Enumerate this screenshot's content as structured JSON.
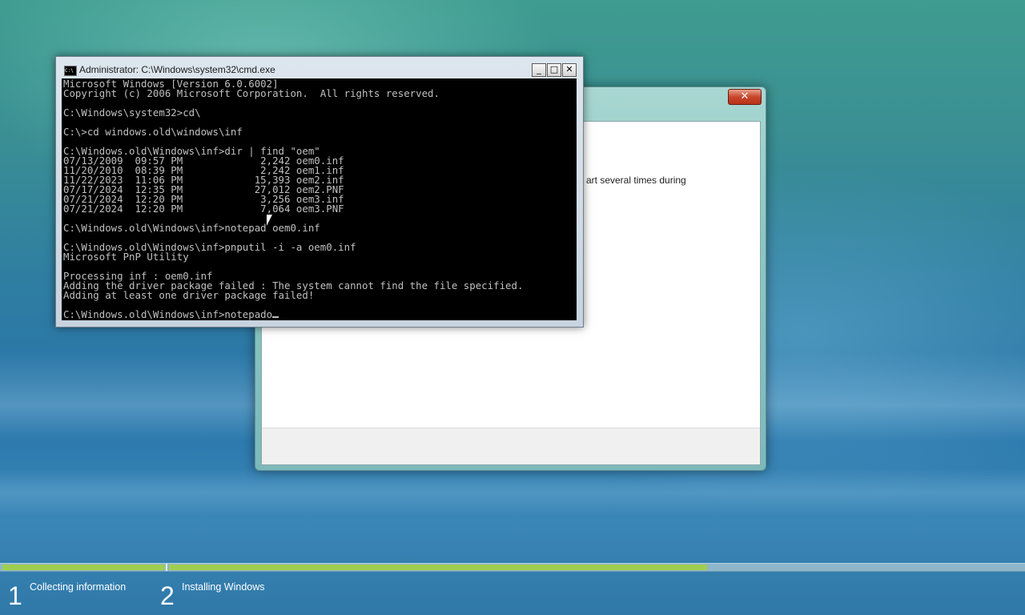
{
  "cmd": {
    "title": "Administrator: C:\\Windows\\system32\\cmd.exe",
    "icon": "cmd-icon",
    "buttons": {
      "minimize": "_",
      "maximize": "□",
      "close": "✕"
    },
    "output": "Microsoft Windows [Version 6.0.6002]\nCopyright (c) 2006 Microsoft Corporation.  All rights reserved.\n\nC:\\Windows\\system32>cd\\\n\nC:\\>cd windows.old\\windows\\inf\n\nC:\\Windows.old\\Windows\\inf>dir | find \"oem\"\n07/13/2009  09:57 PM             2,242 oem0.inf\n11/20/2010  08:39 PM             2,242 oem1.inf\n11/22/2023  11:06 PM            15,393 oem2.inf\n07/17/2024  12:35 PM            27,012 oem2.PNF\n07/21/2024  12:20 PM             3,256 oem3.inf\n07/21/2024  12:20 PM             7,064 oem3.PNF\n\nC:\\Windows.old\\Windows\\inf>notepad oem0.inf\n\nC:\\Windows.old\\Windows\\inf>pnputil -i -a oem0.inf\nMicrosoft PnP Utility\n\nProcessing inf : oem0.inf\nAdding the driver package failed : The system cannot find the file specified.\nAdding at least one driver package failed!\n\nC:\\Windows.old\\Windows\\inf>notepado"
  },
  "setup": {
    "close_label": "✕",
    "partial_text": "art several times during"
  },
  "progress": {
    "segment2_fraction": 0.63
  },
  "steps": [
    {
      "number": "1",
      "label": "Collecting information"
    },
    {
      "number": "2",
      "label": "Installing Windows"
    }
  ],
  "colors": {
    "progress_fill": "#9fce4f",
    "console_text": "#c0c0c0",
    "console_bg": "#000000"
  }
}
